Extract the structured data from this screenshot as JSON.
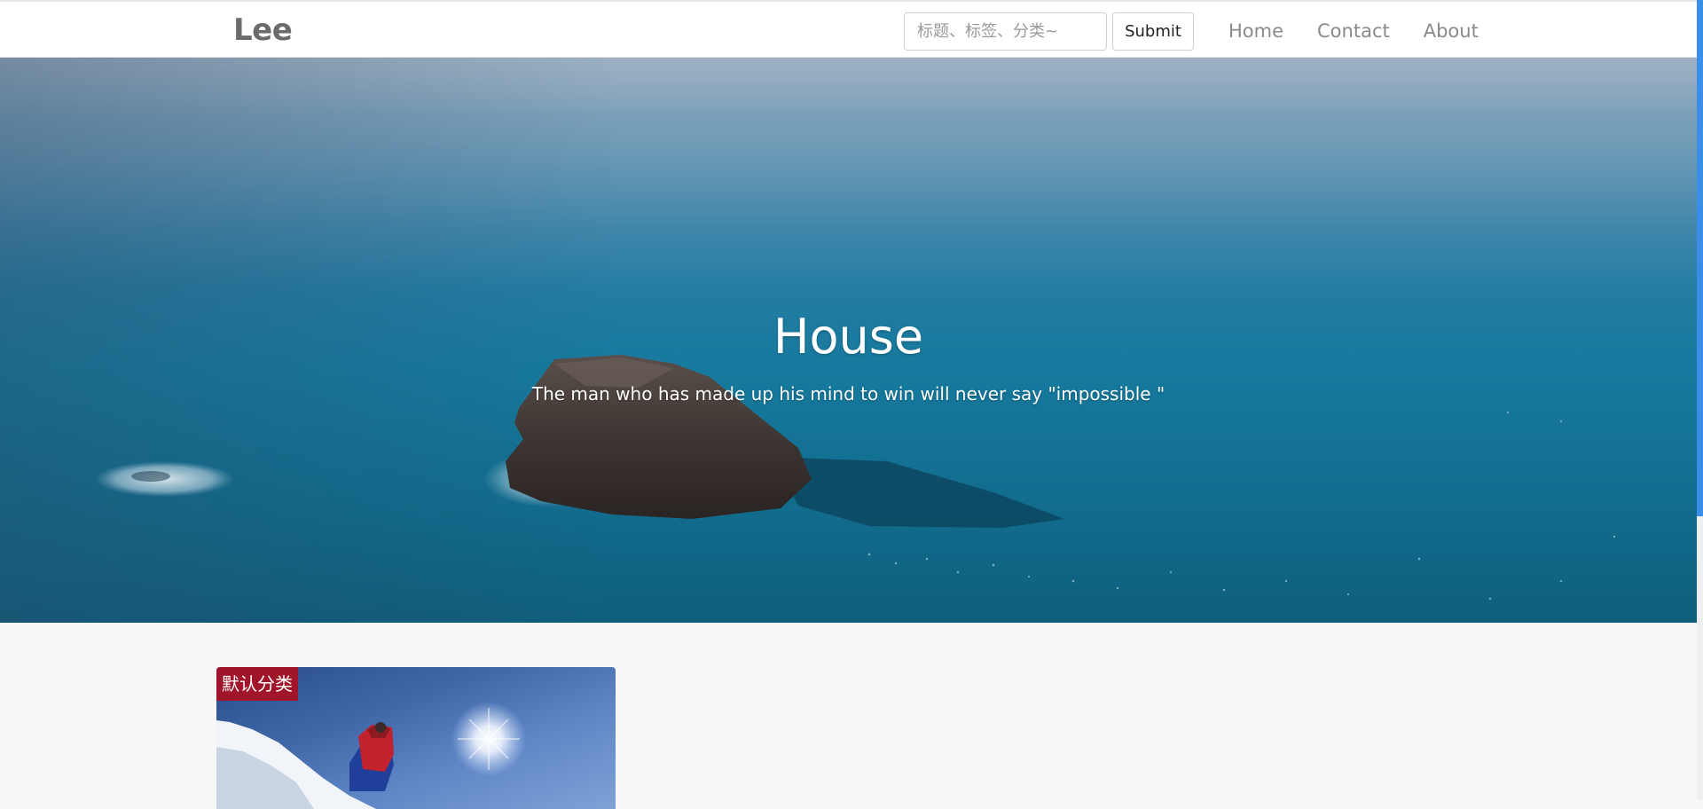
{
  "navbar": {
    "brand": "Lee",
    "search": {
      "placeholder": "标题、标签、分类~",
      "value": ""
    },
    "submit_label": "Submit",
    "links": [
      {
        "label": "Home"
      },
      {
        "label": "Contact"
      },
      {
        "label": "About"
      }
    ]
  },
  "hero": {
    "title": "House",
    "subtitle": "The man who has made up his mind to win will never say \"impossible \""
  },
  "posts": [
    {
      "category": "默认分类",
      "category_color": "#a1152a"
    }
  ],
  "colors": {
    "accent": "#3a8ee8",
    "badge": "#a1152a",
    "nav_text": "#8a8a8a",
    "brand_text": "#6b6b6b"
  }
}
